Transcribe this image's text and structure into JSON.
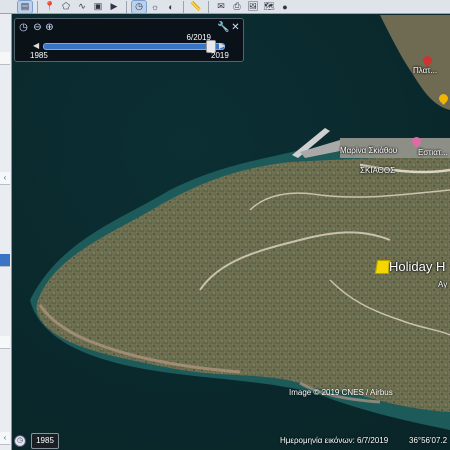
{
  "toolbar": {
    "buttons": [
      "sidebar",
      "placemark",
      "polygon",
      "path",
      "image-overlay",
      "tour",
      "historical-imagery",
      "sun",
      "planets",
      "ruler",
      "email",
      "print",
      "save-image",
      "maps",
      "earth"
    ]
  },
  "timeslider": {
    "current_date": "6/2019",
    "start_year": "1985",
    "end_year": "2019",
    "position_fraction": 0.95
  },
  "map": {
    "poi_top": "Πλατ...",
    "poi_marina": "Μαρίνα Σκιάθου",
    "poi_marina_suffix": "Εστιατ...",
    "poi_harbor": "ΣΚΙΑΘΟΣ",
    "hotel_label": "Holiday H",
    "hotel_sub": "Αγ"
  },
  "status": {
    "year_button": "1985",
    "imagery_credit": "Image © 2019 CNES / Airbus",
    "imagery_date": "Ημερομηνία εικόνων: 6/7/2019",
    "coordinates": "36°56'07.2"
  }
}
